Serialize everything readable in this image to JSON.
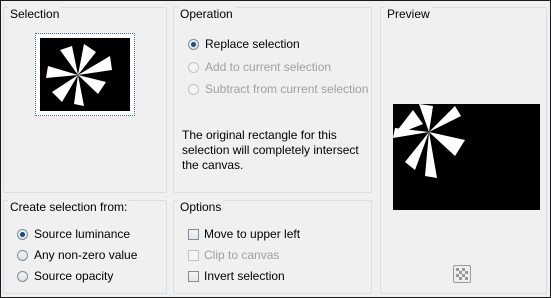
{
  "selection_group": {
    "title": "Selection"
  },
  "operation_group": {
    "title": "Operation",
    "options": [
      {
        "label": "Replace selection",
        "checked": true,
        "enabled": true
      },
      {
        "label": "Add to current selection",
        "checked": false,
        "enabled": false
      },
      {
        "label": "Subtract from current selection",
        "checked": false,
        "enabled": false
      }
    ],
    "info": "The original rectangle for this selection will completely intersect the canvas."
  },
  "preview_group": {
    "title": "Preview",
    "icon": "checkerboard-icon"
  },
  "create_group": {
    "title": "Create selection from:",
    "options": [
      {
        "label": "Source luminance",
        "checked": true
      },
      {
        "label": "Any non-zero value",
        "checked": false
      },
      {
        "label": "Source opacity",
        "checked": false
      }
    ]
  },
  "options_group": {
    "title": "Options",
    "items": [
      {
        "label": "Move to upper left",
        "checked": false,
        "enabled": true
      },
      {
        "label": "Clip to canvas",
        "checked": false,
        "enabled": false
      },
      {
        "label": "Invert selection",
        "checked": false,
        "enabled": true
      }
    ]
  }
}
